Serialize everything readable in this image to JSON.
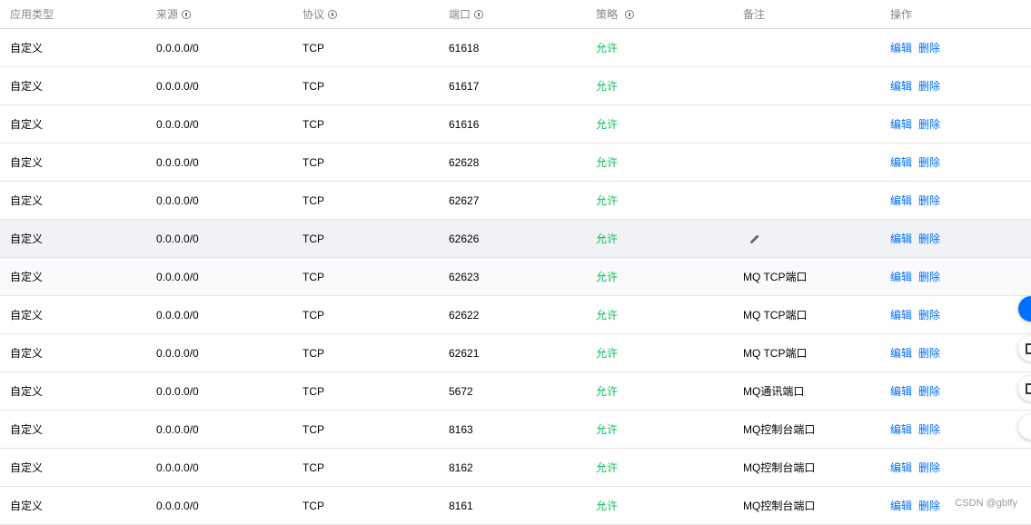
{
  "headers": {
    "app_type": "应用类型",
    "source": "来源",
    "protocol": "协议",
    "port": "端口",
    "policy": "策略",
    "remark": "备注",
    "action": "操作"
  },
  "rows": [
    {
      "app_type": "自定义",
      "source": "0.0.0.0/0",
      "protocol": "TCP",
      "port": "61618",
      "policy": "允许",
      "remark": "",
      "edit": "编辑",
      "delete": "删除"
    },
    {
      "app_type": "自定义",
      "source": "0.0.0.0/0",
      "protocol": "TCP",
      "port": "61617",
      "policy": "允许",
      "remark": "",
      "edit": "编辑",
      "delete": "删除"
    },
    {
      "app_type": "自定义",
      "source": "0.0.0.0/0",
      "protocol": "TCP",
      "port": "61616",
      "policy": "允许",
      "remark": "",
      "edit": "编辑",
      "delete": "删除"
    },
    {
      "app_type": "自定义",
      "source": "0.0.0.0/0",
      "protocol": "TCP",
      "port": "62628",
      "policy": "允许",
      "remark": "",
      "edit": "编辑",
      "delete": "删除"
    },
    {
      "app_type": "自定义",
      "source": "0.0.0.0/0",
      "protocol": "TCP",
      "port": "62627",
      "policy": "允许",
      "remark": "",
      "edit": "编辑",
      "delete": "删除"
    },
    {
      "app_type": "自定义",
      "source": "0.0.0.0/0",
      "protocol": "TCP",
      "port": "62626",
      "policy": "允许",
      "remark": "",
      "edit": "编辑",
      "delete": "删除"
    },
    {
      "app_type": "自定义",
      "source": "0.0.0.0/0",
      "protocol": "TCP",
      "port": "62623",
      "policy": "允许",
      "remark": "MQ TCP端口",
      "edit": "编辑",
      "delete": "删除"
    },
    {
      "app_type": "自定义",
      "source": "0.0.0.0/0",
      "protocol": "TCP",
      "port": "62622",
      "policy": "允许",
      "remark": "MQ TCP端口",
      "edit": "编辑",
      "delete": "删除"
    },
    {
      "app_type": "自定义",
      "source": "0.0.0.0/0",
      "protocol": "TCP",
      "port": "62621",
      "policy": "允许",
      "remark": "MQ TCP端口",
      "edit": "编辑",
      "delete": "删除"
    },
    {
      "app_type": "自定义",
      "source": "0.0.0.0/0",
      "protocol": "TCP",
      "port": "5672",
      "policy": "允许",
      "remark": "MQ通讯端口",
      "edit": "编辑",
      "delete": "删除"
    },
    {
      "app_type": "自定义",
      "source": "0.0.0.0/0",
      "protocol": "TCP",
      "port": "8163",
      "policy": "允许",
      "remark": "MQ控制台端口",
      "edit": "编辑",
      "delete": "删除"
    },
    {
      "app_type": "自定义",
      "source": "0.0.0.0/0",
      "protocol": "TCP",
      "port": "8162",
      "policy": "允许",
      "remark": "MQ控制台端口",
      "edit": "编辑",
      "delete": "删除"
    },
    {
      "app_type": "自定义",
      "source": "0.0.0.0/0",
      "protocol": "TCP",
      "port": "8161",
      "policy": "允许",
      "remark": "MQ控制台端口",
      "edit": "编辑",
      "delete": "删除"
    }
  ],
  "watermark": "CSDN @gblfy",
  "colors": {
    "link": "#006eff",
    "allow": "#0abf5b",
    "hover_row": "#f0f2f5"
  }
}
